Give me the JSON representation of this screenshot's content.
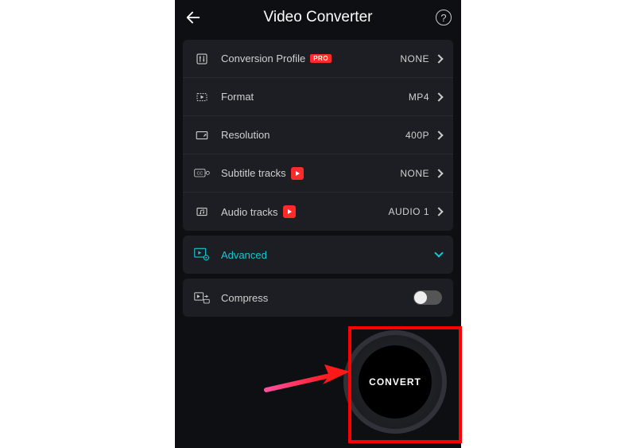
{
  "header": {
    "title": "Video Converter",
    "help": "?"
  },
  "settings": [
    {
      "icon": "sliders",
      "label": "Conversion Profile",
      "badge": "PRO",
      "value": "NONE"
    },
    {
      "icon": "format",
      "label": "Format",
      "value": "MP4"
    },
    {
      "icon": "resolution",
      "label": "Resolution",
      "value": "400P"
    },
    {
      "icon": "cc",
      "label": "Subtitle tracks",
      "reddot": true,
      "value": "NONE"
    },
    {
      "icon": "audio",
      "label": "Audio tracks",
      "reddot": true,
      "value": "AUDIO 1"
    }
  ],
  "advanced": {
    "label": "Advanced"
  },
  "compress": {
    "label": "Compress",
    "enabled": false
  },
  "convert": {
    "label": "CONVERT"
  },
  "colors": {
    "accent": "#18c6d4",
    "danger": "#ff2a2a"
  }
}
